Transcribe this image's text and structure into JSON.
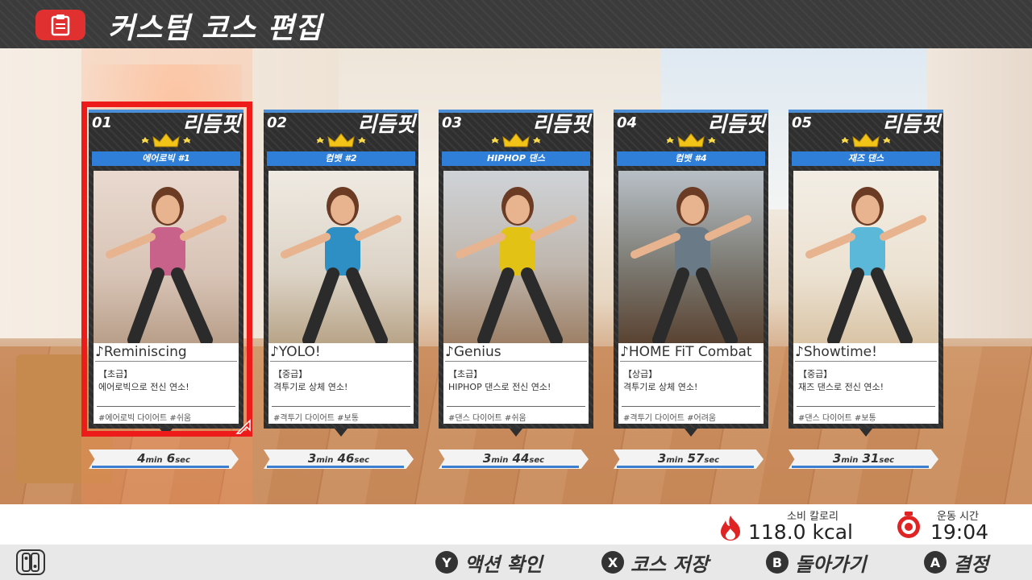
{
  "header": {
    "title": "커스텀 코스 편집",
    "icon": "clipboard-icon"
  },
  "brand_color": "#e03030",
  "selected_index": 0,
  "cards": [
    {
      "num": "01",
      "logo": "리듬핏",
      "label": "에어로빅 #1",
      "song": "♪Reminiscing",
      "level": "【초급】",
      "desc": "에어로빅으로 전신 연소!",
      "tags": "#에어로빅 다이어트 #쉬움",
      "time_min": "4",
      "time_sec": "6",
      "min_unit": "min",
      "sec_unit": "sec"
    },
    {
      "num": "02",
      "logo": "리듬핏",
      "label": "컴뱃 #2",
      "song": "♪YOLO!",
      "level": "【중급】",
      "desc": "격투기로 상체 연소!",
      "tags": "#격투기 다이어트 #보통",
      "time_min": "3",
      "time_sec": "46",
      "min_unit": "min",
      "sec_unit": "sec"
    },
    {
      "num": "03",
      "logo": "리듬핏",
      "label": "HIPHOP 댄스",
      "song": "♪Genius",
      "level": "【초급】",
      "desc": "HIPHOP 댄스로 전신 연소!",
      "tags": "#댄스 다이어트 #쉬움",
      "time_min": "3",
      "time_sec": "44",
      "min_unit": "min",
      "sec_unit": "sec"
    },
    {
      "num": "04",
      "logo": "리듬핏",
      "label": "컴뱃 #4",
      "song": "♪HOME FiT Combat",
      "level": "【상급】",
      "desc": "격투기로 상체 연소!",
      "tags": "#격투기 다이어트 #어려움",
      "time_min": "3",
      "time_sec": "57",
      "min_unit": "min",
      "sec_unit": "sec"
    },
    {
      "num": "05",
      "logo": "리듬핏",
      "label": "재즈 댄스",
      "song": "♪Showtime!",
      "level": "【중급】",
      "desc": "재즈 댄스로 전신 연소!",
      "tags": "#댄스 다이어트 #보통",
      "time_min": "3",
      "time_sec": "31",
      "min_unit": "min",
      "sec_unit": "sec"
    }
  ],
  "stats": {
    "calories_label": "소비 칼로리",
    "calories_value": "118.0 kcal",
    "time_label": "운동 시간",
    "time_value": "19:04"
  },
  "footer": {
    "buttons": [
      {
        "key": "Y",
        "label": "액션 확인"
      },
      {
        "key": "X",
        "label": "코스 저장"
      },
      {
        "key": "B",
        "label": "돌아가기"
      },
      {
        "key": "A",
        "label": "결정"
      }
    ]
  }
}
